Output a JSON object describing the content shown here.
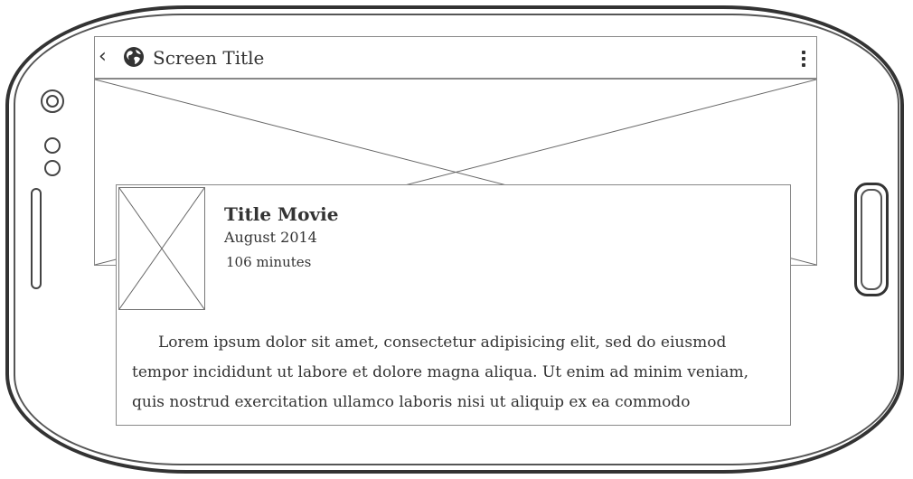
{
  "app_bar": {
    "back_icon": "chevron-left-icon",
    "app_icon": "globe-icon",
    "title": "Screen Title",
    "menu_icon": "more-vertical-icon"
  },
  "hero_image": {
    "placeholder": "image-placeholder"
  },
  "movie_card": {
    "thumbnail": "image-placeholder",
    "title": "Title Movie",
    "date": "August 2014",
    "duration": "106 minutes",
    "description": "Lorem ipsum dolor sit amet, consectetur adipisicing elit, sed do eiusmod tempor incididunt ut labore et dolore magna aliqua. Ut enim ad minim veniam, quis nostrud exercitation ullamco laboris nisi ut aliquip ex ea commodo consequat. Duis aute irure dolor in reprehenderit in voluptate velit esse cillum"
  }
}
